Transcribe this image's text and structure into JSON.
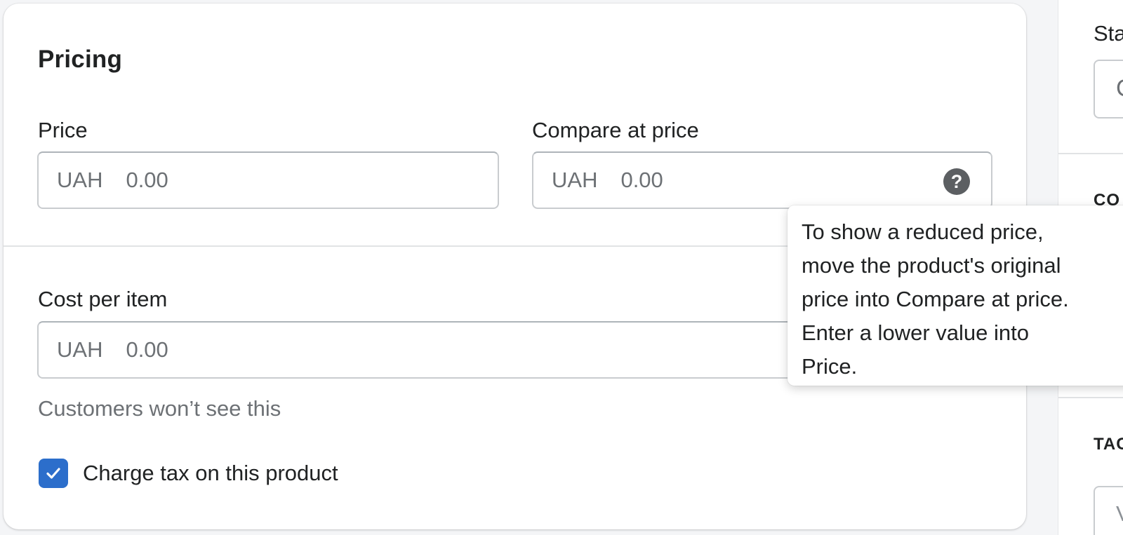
{
  "pricing": {
    "title": "Pricing",
    "price": {
      "label": "Price",
      "currency": "UAH",
      "placeholder": "0.00"
    },
    "compare_at_price": {
      "label": "Compare at price",
      "currency": "UAH",
      "placeholder": "0.00",
      "help_icon": "question-circle-icon"
    },
    "cost_per_item": {
      "label": "Cost per item",
      "currency": "UAH",
      "placeholder": "0.00",
      "help_text": "Customers won’t see this"
    },
    "charge_tax": {
      "label": "Charge tax on this product",
      "checked": true
    }
  },
  "tooltip": {
    "lines": [
      "To show a reduced price,",
      "move the product's original",
      "price into Compare at price.",
      "Enter a lower value into",
      "Price."
    ]
  },
  "right_panel": {
    "status_label": "Sta",
    "select_glyph": "C",
    "section_heading_1": "CO",
    "section_heading_2": "TAC",
    "input_glyph": "V"
  },
  "colors": {
    "accent": "#2c6ecb",
    "icon": "#5c5f62",
    "border": "#c9cccf",
    "muted_text": "#6d7175",
    "text": "#202223",
    "background": "#f4f5f7"
  }
}
